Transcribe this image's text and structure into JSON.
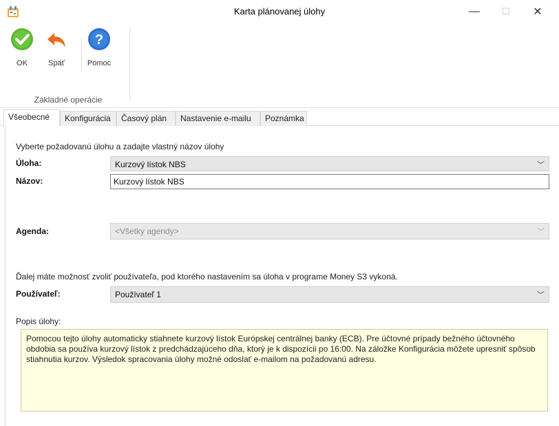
{
  "window": {
    "title": "Karta plánovanej úlohy",
    "minimize_glyph": "—",
    "maximize_glyph": "☐",
    "close_glyph": "✕",
    "app_icon": "app-icon"
  },
  "ribbon": {
    "buttons": [
      {
        "label": "OK",
        "icon": "check-icon",
        "color": "#5cb531"
      },
      {
        "label": "Späť",
        "icon": "undo-arrow-icon",
        "color": "#e96b1f"
      },
      {
        "label": "Pomoc",
        "icon": "help-icon",
        "color": "#2a6fcf"
      }
    ],
    "group_label": "Základné operácie"
  },
  "tabs": [
    {
      "label": "Všeobecné",
      "active": true
    },
    {
      "label": "Konfigurácia",
      "active": false
    },
    {
      "label": "Časový plán",
      "active": false
    },
    {
      "label": "Nastavenie e-mailu",
      "active": false
    },
    {
      "label": "Poznámka",
      "active": false
    }
  ],
  "form": {
    "intro": "Vyberte požadovanú úlohu a zadajte vlastný názov úlohy",
    "task_label": "Úloha:",
    "task_value": "Kurzový lístok NBS",
    "name_label": "Názov:",
    "name_value": "Kurzový lístok NBS",
    "agenda_label": "Agenda:",
    "agenda_value": "<Všetky agendy>",
    "user_intro": "Ďalej máte  možnosť zvoliť používateľa, pod ktorého nastavením sa úloha v programe Money S3 vykoná.",
    "user_label": "Používateľ:",
    "user_value": "Používateľ 1",
    "desc_label": "Popis úlohy:",
    "desc_text": "Pomocou tejto úlohy automaticky stiahnete kurzový lístok Európskej centrálnej banky (ECB). Pre účtovné prípady bežného účtovného obdobia sa používa kurzový lístok z predchádzajúceho dňa, ktorý je k dispozícii po 16:00. Na záložke Konfigurácia môžete upresniť spôsob stiahnutia kurzov. Výsledok spracovania úlohy možné odoslať e-mailom na požadovanú adresu.",
    "dropdown_glyph": "﹀"
  }
}
